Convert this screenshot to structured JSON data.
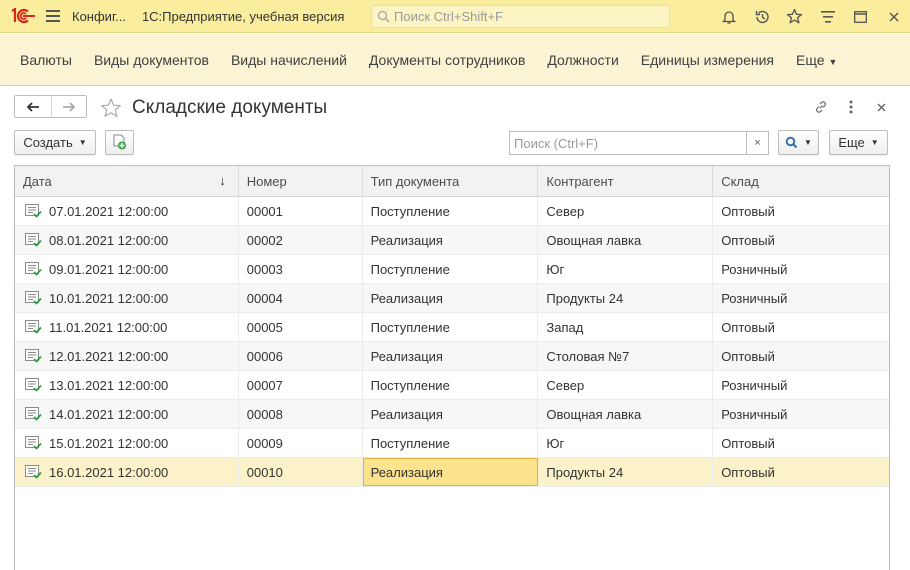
{
  "topbar": {
    "config_title": "Конфиг...",
    "app_title": "1С:Предприятие, учебная версия",
    "search_placeholder": "Поиск Ctrl+Shift+F",
    "icons": [
      "1c-logo-icon",
      "hamburger-menu-icon",
      "bell-icon",
      "history-icon",
      "star-icon",
      "funnel-menu-icon",
      "window-icon",
      "close-icon"
    ],
    "accent_color": "#fbed9e"
  },
  "sections": [
    {
      "label": "Валюты"
    },
    {
      "label": "Виды документов"
    },
    {
      "label": "Виды начислений"
    },
    {
      "label": "Документы сотрудников"
    },
    {
      "label": "Должности"
    },
    {
      "label": "Единицы измерения"
    },
    {
      "label": "Еще"
    }
  ],
  "form": {
    "title": "Складские документы",
    "create_label": "Создать",
    "search_placeholder": "Поиск (Ctrl+F)",
    "clear_label": "×",
    "more_label": "Еще"
  },
  "table": {
    "columns": [
      "Дата",
      "Номер",
      "Тип документа",
      "Контрагент",
      "Склад"
    ],
    "sorted_column": "Дата",
    "sort_direction": "descending-arrow",
    "selected_row": 9,
    "focused_cell": "Тип документа",
    "rows": [
      {
        "date": "07.01.2021 12:00:00",
        "number": "00001",
        "type": "Поступление",
        "counterparty": "Север",
        "warehouse": "Оптовый"
      },
      {
        "date": "08.01.2021 12:00:00",
        "number": "00002",
        "type": "Реализация",
        "counterparty": "Овощная лавка",
        "warehouse": "Оптовый"
      },
      {
        "date": "09.01.2021 12:00:00",
        "number": "00003",
        "type": "Поступление",
        "counterparty": "Юг",
        "warehouse": "Розничный"
      },
      {
        "date": "10.01.2021 12:00:00",
        "number": "00004",
        "type": "Реализация",
        "counterparty": "Продукты 24",
        "warehouse": "Розничный"
      },
      {
        "date": "11.01.2021 12:00:00",
        "number": "00005",
        "type": "Поступление",
        "counterparty": "Запад",
        "warehouse": "Оптовый"
      },
      {
        "date": "12.01.2021 12:00:00",
        "number": "00006",
        "type": "Реализация",
        "counterparty": "Столовая №7",
        "warehouse": "Оптовый"
      },
      {
        "date": "13.01.2021 12:00:00",
        "number": "00007",
        "type": "Поступление",
        "counterparty": "Север",
        "warehouse": "Розничный"
      },
      {
        "date": "14.01.2021 12:00:00",
        "number": "00008",
        "type": "Реализация",
        "counterparty": "Овощная лавка",
        "warehouse": "Розничный"
      },
      {
        "date": "15.01.2021 12:00:00",
        "number": "00009",
        "type": "Поступление",
        "counterparty": "Юг",
        "warehouse": "Оптовый"
      },
      {
        "date": "16.01.2021 12:00:00",
        "number": "00010",
        "type": "Реализация",
        "counterparty": "Продукты 24",
        "warehouse": "Оптовый"
      }
    ]
  }
}
